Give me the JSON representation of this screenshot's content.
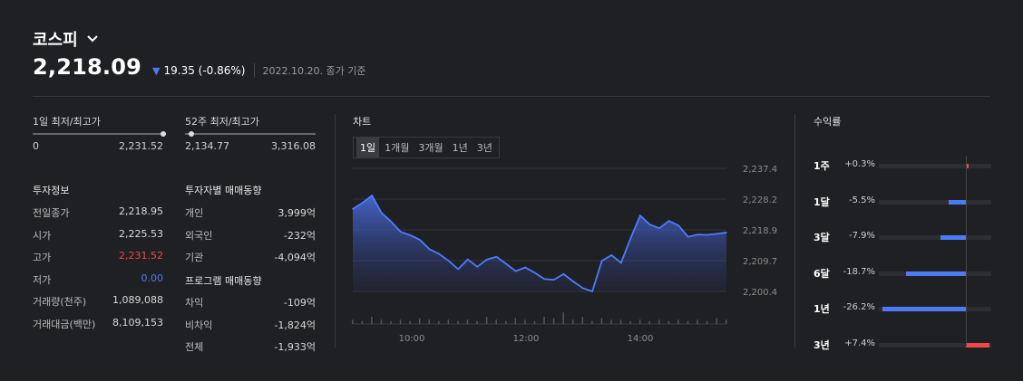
{
  "header": {
    "title": "코스피",
    "price": "2,218.09",
    "change": "19.35 (-0.86%)",
    "base": "2022.10.20. 종가 기준",
    "colors": {
      "down": "#4b7bf5",
      "up": "#f04848"
    }
  },
  "ranges": {
    "day": {
      "label": "1일 최저/최고가",
      "low": "0",
      "high": "2,231.52",
      "position": 1.0
    },
    "week52": {
      "label": "52주 최저/최고가",
      "low": "2,134.77",
      "high": "3,316.08",
      "position": 0.05
    }
  },
  "invest": {
    "title": "투자정보",
    "rows": [
      {
        "k": "전일종가",
        "v": "2,218.95"
      },
      {
        "k": "시가",
        "v": "2,225.53"
      },
      {
        "k": "고가",
        "v": "2,231.52"
      },
      {
        "k": "저가",
        "v": "0.00"
      },
      {
        "k": "거래량(천주)",
        "v": "1,089,088"
      },
      {
        "k": "거래대금(백만)",
        "v": "8,109,153"
      }
    ]
  },
  "investor": {
    "title": "투자자별 매매동향",
    "rows": [
      {
        "k": "개인",
        "v": "3,999억"
      },
      {
        "k": "외국인",
        "v": "-232억"
      },
      {
        "k": "기관",
        "v": "-4,094억"
      }
    ],
    "program_title": "프로그램 매매동향",
    "program_rows": [
      {
        "k": "차익",
        "v": "-109억"
      },
      {
        "k": "비차익",
        "v": "-1,824억"
      },
      {
        "k": "전체",
        "v": "-1,933억"
      }
    ]
  },
  "chart": {
    "title": "차트",
    "tabs": [
      "1일",
      "1개월",
      "3개월",
      "1년",
      "3년"
    ],
    "active_tab": "1일"
  },
  "chart_data": {
    "type": "area",
    "x": [
      "09:00",
      "09:10",
      "09:20",
      "09:30",
      "09:40",
      "09:50",
      "10:00",
      "10:10",
      "10:20",
      "10:30",
      "10:40",
      "10:50",
      "11:00",
      "11:10",
      "11:20",
      "11:30",
      "11:40",
      "11:50",
      "12:00",
      "12:10",
      "12:20",
      "12:30",
      "12:40",
      "12:50",
      "13:00",
      "13:10",
      "13:20",
      "13:30",
      "13:40",
      "13:50",
      "14:00",
      "14:10",
      "14:20",
      "14:30",
      "14:40",
      "14:50",
      "15:00",
      "15:10",
      "15:20",
      "15:30"
    ],
    "values": [
      2225.2,
      2227.0,
      2229.2,
      2224.0,
      2221.4,
      2218.3,
      2217.3,
      2215.9,
      2213.1,
      2211.7,
      2209.6,
      2207.1,
      2210.0,
      2207.8,
      2210.0,
      2210.8,
      2208.7,
      2206.5,
      2207.6,
      2206.0,
      2204.1,
      2203.9,
      2205.6,
      2203.4,
      2201.4,
      2200.4,
      2209.6,
      2211.3,
      2209.0,
      2216.4,
      2223.2,
      2220.5,
      2219.4,
      2221.6,
      2220.2,
      2216.8,
      2217.5,
      2217.4,
      2217.7,
      2218.1
    ],
    "volume_scale": [
      0.3,
      0.2,
      0.5,
      0.3,
      0.2,
      0.3,
      0.2,
      0.4,
      0.3,
      0.2,
      0.3,
      0.2,
      0.3,
      0.2,
      0.5,
      0.3,
      0.2,
      0.4,
      0.3,
      0.2,
      0.5,
      0.4,
      0.8,
      0.3,
      0.5,
      0.2,
      0.4,
      0.3,
      0.3,
      0.2,
      0.3,
      0.2,
      0.3,
      0.2,
      0.3,
      0.2,
      0.3,
      0.2,
      0.4,
      0.3
    ],
    "y_ticks": [
      "2,237.4",
      "2,228.2",
      "2,218.9",
      "2,209.7",
      "2,200.4"
    ],
    "ylim": [
      2200.4,
      2237.4
    ],
    "x_ticks": [
      "10:00",
      "12:00",
      "14:00"
    ],
    "grid": true
  },
  "returns": {
    "title": "수익률",
    "rows": [
      {
        "period": "1주",
        "value": "+0.3%",
        "pct": 0.3
      },
      {
        "period": "1달",
        "value": "-5.5%",
        "pct": -5.5
      },
      {
        "period": "3달",
        "value": "-7.9%",
        "pct": -7.9
      },
      {
        "period": "6달",
        "value": "-18.7%",
        "pct": -18.7
      },
      {
        "period": "1년",
        "value": "-26.2%",
        "pct": -26.2
      },
      {
        "period": "3년",
        "value": "+7.4%",
        "pct": 7.4
      }
    ]
  }
}
